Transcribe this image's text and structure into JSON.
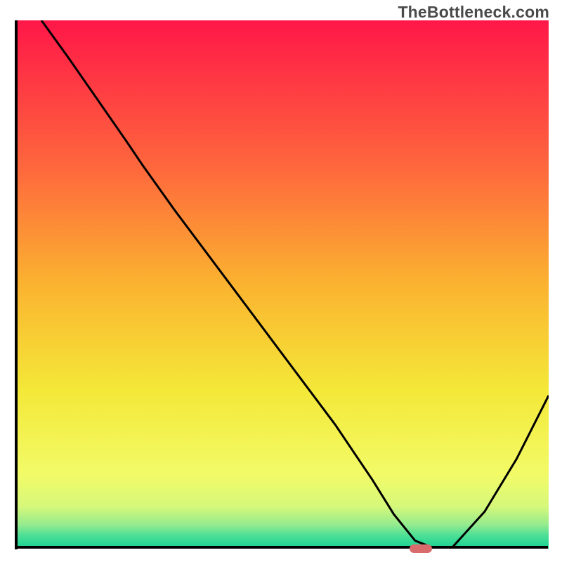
{
  "watermark": "TheBottleneck.com",
  "chart_data": {
    "type": "line",
    "title": "",
    "xlabel": "",
    "ylabel": "",
    "xlim": [
      0,
      100
    ],
    "ylim": [
      0,
      100
    ],
    "grid": false,
    "legend": false,
    "background_gradient": {
      "stops": [
        {
          "offset": 0.0,
          "color": "#ff1748"
        },
        {
          "offset": 0.29,
          "color": "#fe6b3c"
        },
        {
          "offset": 0.5,
          "color": "#fbb330"
        },
        {
          "offset": 0.7,
          "color": "#f4e838"
        },
        {
          "offset": 0.86,
          "color": "#f2fb67"
        },
        {
          "offset": 0.92,
          "color": "#d6f87a"
        },
        {
          "offset": 0.955,
          "color": "#94eb8e"
        },
        {
          "offset": 0.975,
          "color": "#4cdf96"
        },
        {
          "offset": 1.0,
          "color": "#16d193"
        }
      ]
    },
    "series": [
      {
        "name": "bottleneck-curve",
        "color": "#000000",
        "x": [
          5,
          10,
          21,
          24,
          30,
          40,
          50,
          60,
          67,
          71,
          75,
          78,
          82,
          88,
          94,
          100
        ],
        "y": [
          100,
          93,
          77,
          72.5,
          64,
          50.5,
          37,
          23.5,
          13,
          6.5,
          1.5,
          0.3,
          0.3,
          7,
          17,
          29
        ]
      }
    ],
    "marker": {
      "name": "optimal-point",
      "shape": "pill",
      "color": "#d86b6c",
      "x": 76,
      "y": 0,
      "width_units": 4.2,
      "height_units": 1.6
    }
  }
}
